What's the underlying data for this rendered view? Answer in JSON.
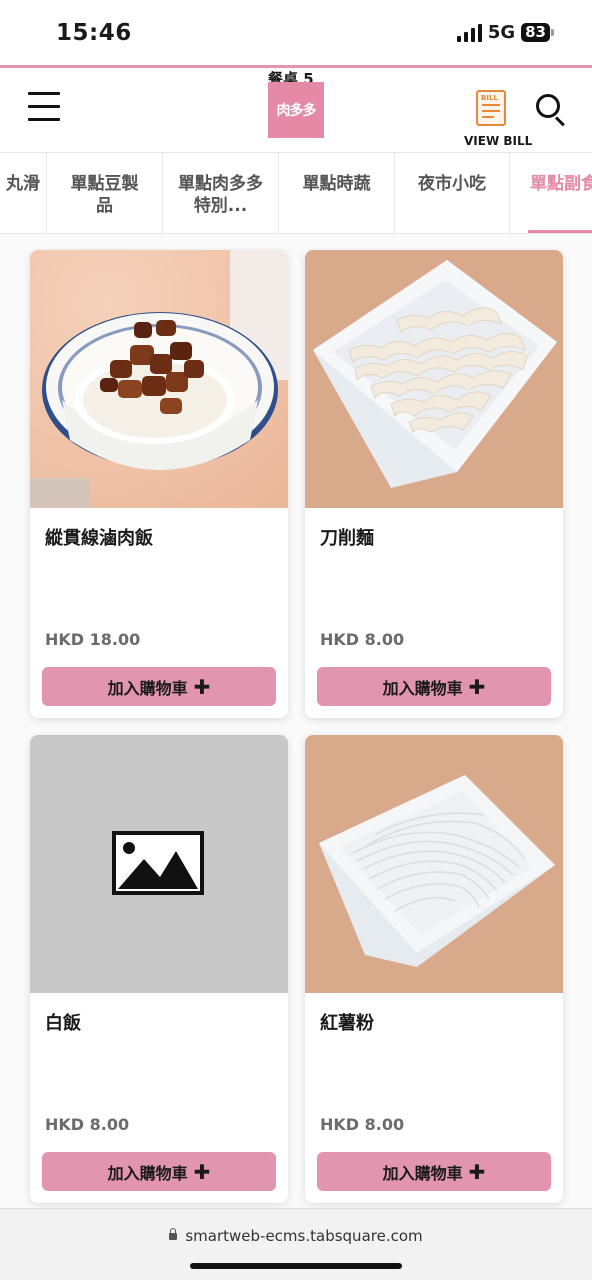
{
  "status": {
    "time": "15:46",
    "network": "5G",
    "battery": "83"
  },
  "header": {
    "table": "餐桌 5",
    "logo_text": "肉多多",
    "bill_tag": "BILL",
    "bill_label": "VIEW BILL",
    "icons": {
      "menu": "hamburger-menu-icon",
      "bill": "receipt-icon",
      "search": "search-icon"
    }
  },
  "tabs": [
    {
      "label": "丸滑"
    },
    {
      "label": "單點豆製品"
    },
    {
      "label": "單點肉多多特別..."
    },
    {
      "label": "單點時蔬"
    },
    {
      "label": "夜市小吃"
    },
    {
      "label": "單點副食",
      "active": true
    }
  ],
  "products": [
    {
      "name": "縱貫線滷肉飯",
      "price": "HKD 18.00",
      "button": "加入購物車",
      "image": "braised-pork-rice"
    },
    {
      "name": "刀削麵",
      "price": "HKD 8.00",
      "button": "加入購物車",
      "image": "knife-cut-noodles"
    },
    {
      "name": "白飯",
      "price": "HKD 8.00",
      "button": "加入購物車",
      "image": "placeholder"
    },
    {
      "name": "紅薯粉",
      "price": "HKD 8.00",
      "button": "加入購物車",
      "image": "sweet-potato-noodles"
    }
  ],
  "browser": {
    "url": "smartweb-ecms.tabsquare.com"
  },
  "colors": {
    "accent": "#e58aa6",
    "button": "#e295ae",
    "bill": "#e7893a"
  }
}
